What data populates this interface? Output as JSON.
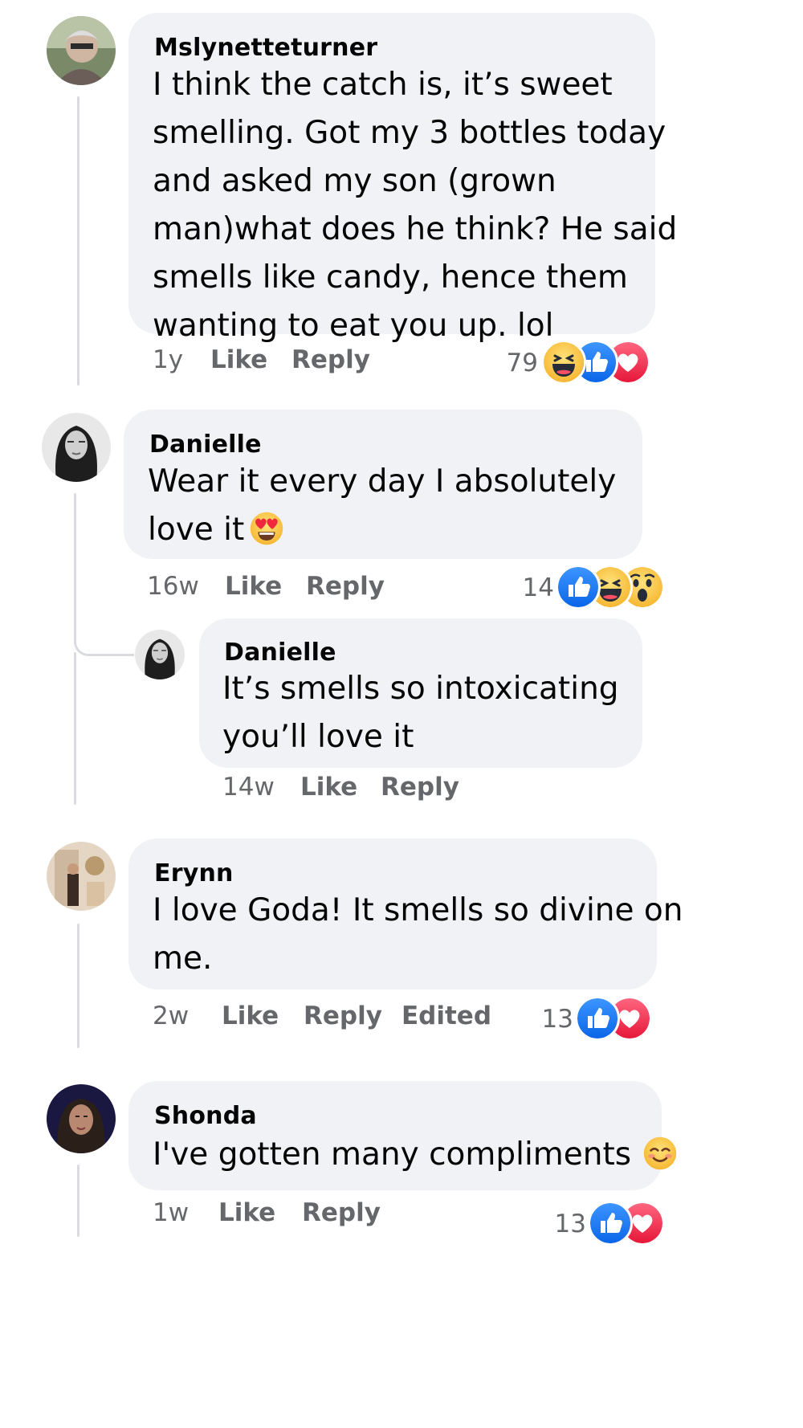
{
  "comments": [
    {
      "author": "Mslynetteturner",
      "lines": [
        "I think the catch is, it’s sweet",
        "smelling. Got my 3 bottles today",
        "and asked my son (grown",
        "man)what does he think? He said",
        "smells like candy, hence them",
        "wanting to eat you up. lol"
      ],
      "time": "1y",
      "like": "Like",
      "reply": "Reply",
      "reaction_count": "79",
      "reactions": [
        "haha-icon",
        "like-icon",
        "love-icon"
      ]
    },
    {
      "author": "Danielle",
      "lines": [
        "Wear it every day I absolutely",
        "love it"
      ],
      "inline_emoji": "heart-eyes-emoji-icon",
      "time": "16w",
      "like": "Like",
      "reply": "Reply",
      "reaction_count": "14",
      "reactions": [
        "like-icon",
        "haha-icon",
        "wow-icon"
      ]
    },
    {
      "author": "Danielle",
      "lines": [
        "It’s smells so intoxicating",
        "you’ll love it"
      ],
      "time": "14w",
      "like": "Like",
      "reply": "Reply"
    },
    {
      "author": "Erynn",
      "lines": [
        "I love Goda! It smells so divine on",
        "me."
      ],
      "time": "2w",
      "like": "Like",
      "reply": "Reply",
      "edited": "Edited",
      "reaction_count": "13",
      "reactions": [
        "like-icon",
        "love-icon"
      ]
    },
    {
      "author": "Shonda",
      "lines": [
        "I've gotten many compliments"
      ],
      "inline_emoji": "smiling-blush-emoji-icon",
      "time": "1w",
      "like": "Like",
      "reply": "Reply",
      "reaction_count": "13",
      "reactions": [
        "like-icon",
        "love-icon"
      ]
    }
  ],
  "colors": {
    "bubble": "#f0f2f5",
    "meta_text": "#65676b",
    "like_blue": "#1877f2",
    "love_red": "#f33e58",
    "emoji_yellow": "#fcc83d",
    "thread_line": "#d9dbdf"
  }
}
